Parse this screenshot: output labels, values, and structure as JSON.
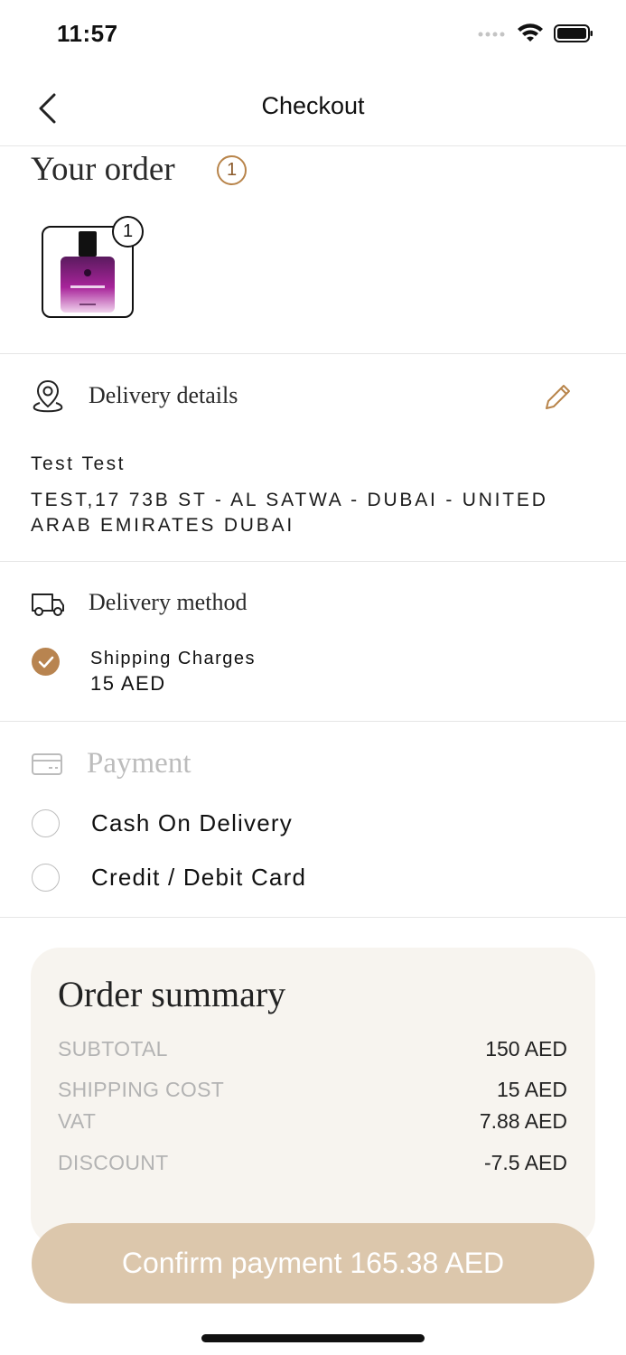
{
  "status_bar": {
    "time": "11:57"
  },
  "nav": {
    "title": "Checkout",
    "back_icon": "chevron-left-icon"
  },
  "order": {
    "title": "Your order",
    "count": "1",
    "product_badge": "1",
    "product_image": "perfume bottle"
  },
  "delivery_details": {
    "title": "Delivery details",
    "name": "Test Test",
    "address": "TEST,17 73B ST - AL SATWA - DUBAI - UNITED ARAB EMIRATES DUBAI"
  },
  "delivery_method": {
    "title": "Delivery method",
    "option_label": "Shipping Charges",
    "option_price": "15 AED"
  },
  "payment": {
    "title": "Payment",
    "options": [
      {
        "label": "Cash On Delivery",
        "selected": false
      },
      {
        "label": "Credit / Debit Card",
        "selected": false
      }
    ]
  },
  "summary": {
    "title": "Order summary",
    "rows": [
      {
        "label": "SUBTOTAL",
        "value": "150 AED"
      },
      {
        "label": "SHIPPING COST",
        "value": "15 AED"
      },
      {
        "label": "VAT",
        "value": "7.88 AED"
      },
      {
        "label": "DISCOUNT",
        "value": "-7.5 AED"
      }
    ]
  },
  "confirm_button": {
    "label": "Confirm payment 165.38 AED"
  },
  "colors": {
    "accent": "#b88450",
    "button": "#dcc7ac",
    "card": "#f7f4ef"
  }
}
